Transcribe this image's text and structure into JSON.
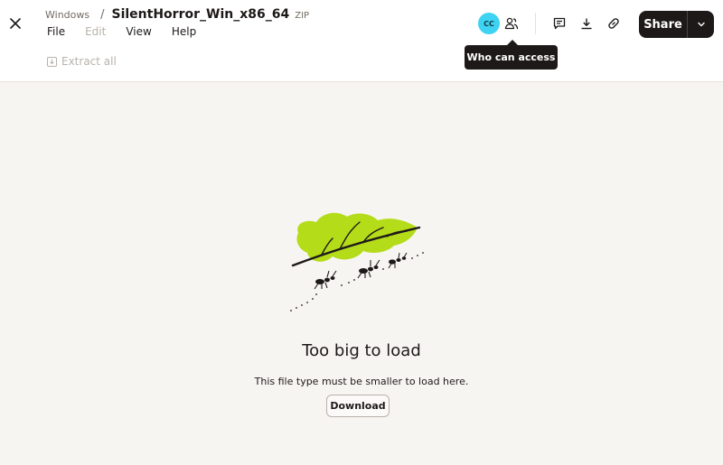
{
  "header": {
    "close_icon": "close-icon",
    "breadcrumb_parent": "Windows",
    "breadcrumb_separator": "/",
    "file_name": "SilentHorror_Win_x86_64",
    "file_type": "ZIP"
  },
  "menu": {
    "items": [
      {
        "label": "File",
        "enabled": true
      },
      {
        "label": "Edit",
        "enabled": false
      },
      {
        "label": "View",
        "enabled": true
      },
      {
        "label": "Help",
        "enabled": true
      }
    ]
  },
  "toolbar": {
    "extract_all": "Extract all",
    "extract_icon": "extract-icon"
  },
  "actions": {
    "avatar_initials": "CC",
    "avatar_color": "#3ed3f2",
    "access_icon": "people-icon",
    "comment_icon": "comment-icon",
    "download_icon": "download-icon",
    "link_icon": "link-icon",
    "share_label": "Share",
    "share_menu_icon": "chevron-down-icon"
  },
  "tooltip": {
    "text": "Who can access"
  },
  "empty_state": {
    "title": "Too big to load",
    "message": "This file type must be smaller to load here.",
    "download_label": "Download",
    "illustration": "ants-carrying-leaf",
    "leaf_color": "#b4dc19"
  }
}
